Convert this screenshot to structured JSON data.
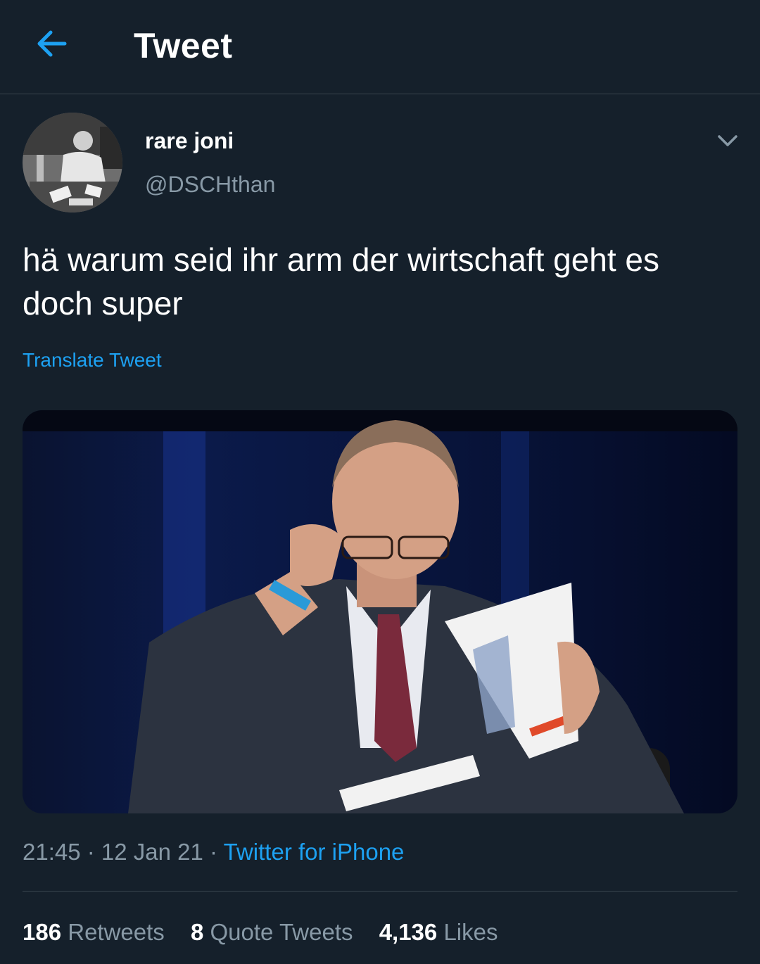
{
  "header": {
    "title": "Tweet",
    "back_icon": "arrow-left-icon"
  },
  "author": {
    "display_name": "rare joni",
    "handle": "@DSCHthan",
    "avatar_icon": "avatar-photo"
  },
  "tweet": {
    "text": "hä warum seid ihr arm der wirtschaft geht es doch super",
    "translate_label": "Translate Tweet"
  },
  "meta": {
    "time": "21:45",
    "sep1": " · ",
    "date": "12 Jan 21",
    "sep2": " · ",
    "client": "Twitter for iPhone"
  },
  "stats": {
    "retweets_count": "186",
    "retweets_label": "Retweets",
    "quotes_count": "8",
    "quotes_label": "Quote Tweets",
    "likes_count": "4,136",
    "likes_label": "Likes"
  },
  "colors": {
    "background": "#15202b",
    "accent": "#1da1f2",
    "secondary_text": "#8899a6",
    "divider": "#38444d"
  }
}
